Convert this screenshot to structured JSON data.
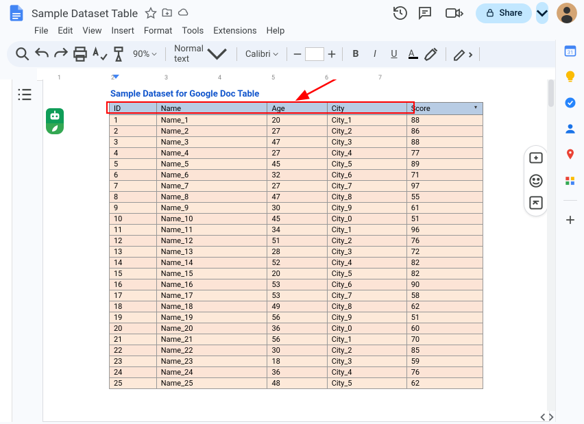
{
  "header": {
    "title": "Sample Dataset Table",
    "menus": [
      "File",
      "Edit",
      "View",
      "Insert",
      "Format",
      "Tools",
      "Extensions",
      "Help"
    ]
  },
  "toolbar": {
    "zoom": "90%",
    "style": "Normal text",
    "font": "Calibri",
    "fontSize": "",
    "textColor": "#ff0000",
    "highlightColor": "#ffff00",
    "shareLabel": "Share"
  },
  "document": {
    "tableTitle": "Sample Dataset for Google Doc Table",
    "columns": [
      "ID",
      "Name",
      "Age",
      "City",
      "Score"
    ],
    "rows": [
      [
        "1",
        "Name_1",
        "20",
        "City_1",
        "88"
      ],
      [
        "2",
        "Name_2",
        "27",
        "City_2",
        "86"
      ],
      [
        "3",
        "Name_3",
        "47",
        "City_3",
        "88"
      ],
      [
        "4",
        "Name_4",
        "27",
        "City_4",
        "77"
      ],
      [
        "5",
        "Name_5",
        "45",
        "City_5",
        "89"
      ],
      [
        "6",
        "Name_6",
        "32",
        "City_6",
        "71"
      ],
      [
        "7",
        "Name_7",
        "27",
        "City_7",
        "97"
      ],
      [
        "8",
        "Name_8",
        "47",
        "City_8",
        "55"
      ],
      [
        "9",
        "Name_9",
        "30",
        "City_9",
        "61"
      ],
      [
        "10",
        "Name_10",
        "45",
        "City_0",
        "51"
      ],
      [
        "11",
        "Name_11",
        "34",
        "City_1",
        "96"
      ],
      [
        "12",
        "Name_12",
        "51",
        "City_2",
        "76"
      ],
      [
        "13",
        "Name_13",
        "28",
        "City_3",
        "72"
      ],
      [
        "14",
        "Name_14",
        "52",
        "City_4",
        "82"
      ],
      [
        "15",
        "Name_15",
        "20",
        "City_5",
        "82"
      ],
      [
        "16",
        "Name_16",
        "53",
        "City_6",
        "90"
      ],
      [
        "17",
        "Name_17",
        "53",
        "City_7",
        "58"
      ],
      [
        "18",
        "Name_18",
        "49",
        "City_8",
        "62"
      ],
      [
        "19",
        "Name_19",
        "56",
        "City_9",
        "51"
      ],
      [
        "20",
        "Name_20",
        "36",
        "City_0",
        "60"
      ],
      [
        "21",
        "Name_21",
        "56",
        "City_1",
        "70"
      ],
      [
        "22",
        "Name_22",
        "30",
        "City_2",
        "85"
      ],
      [
        "23",
        "Name_23",
        "18",
        "City_3",
        "59"
      ],
      [
        "24",
        "Name_24",
        "36",
        "City_4",
        "76"
      ],
      [
        "25",
        "Name_25",
        "48",
        "City_5",
        "62"
      ]
    ]
  },
  "ruler": {
    "marks": [
      "1",
      "2",
      "3",
      "4",
      "5",
      "6",
      "7"
    ]
  },
  "sidebarIcons": [
    "calendar",
    "keep",
    "tasks",
    "contacts",
    "maps",
    "companion",
    "add"
  ]
}
